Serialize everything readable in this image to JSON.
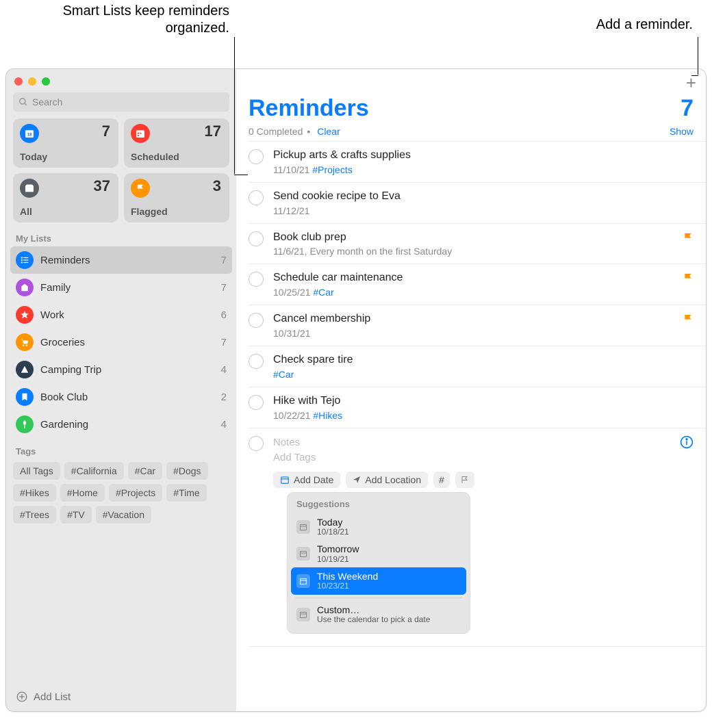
{
  "callouts": {
    "left": "Smart Lists keep reminders organized.",
    "right": "Add a reminder."
  },
  "search": {
    "placeholder": "Search"
  },
  "smart": [
    {
      "label": "Today",
      "count": "7",
      "color": "bg-blue"
    },
    {
      "label": "Scheduled",
      "count": "17",
      "color": "bg-red"
    },
    {
      "label": "All",
      "count": "37",
      "color": "bg-dark"
    },
    {
      "label": "Flagged",
      "count": "3",
      "color": "bg-orange"
    }
  ],
  "mylists_header": "My Lists",
  "lists": [
    {
      "name": "Reminders",
      "count": "7",
      "color": "bg-bluec",
      "selected": true
    },
    {
      "name": "Family",
      "count": "7",
      "color": "bg-purple"
    },
    {
      "name": "Work",
      "count": "6",
      "color": "bg-redc"
    },
    {
      "name": "Groceries",
      "count": "7",
      "color": "bg-orangec"
    },
    {
      "name": "Camping Trip",
      "count": "4",
      "color": "bg-navy"
    },
    {
      "name": "Book Club",
      "count": "2",
      "color": "bg-skyblue"
    },
    {
      "name": "Gardening",
      "count": "4",
      "color": "bg-darkgreen"
    }
  ],
  "tags_header": "Tags",
  "tags": [
    "All Tags",
    "#California",
    "#Car",
    "#Dogs",
    "#Hikes",
    "#Home",
    "#Projects",
    "#Time",
    "#Trees",
    "#TV",
    "#Vacation"
  ],
  "add_list": "Add List",
  "main": {
    "title": "Reminders",
    "count": "7",
    "completed": "0 Completed",
    "dot": "•",
    "clear": "Clear",
    "show": "Show"
  },
  "reminders": [
    {
      "title": "Pickup arts & crafts supplies",
      "meta_date": "11/10/21",
      "meta_tag": "#Projects",
      "flag": false
    },
    {
      "title": "Send cookie recipe to Eva",
      "meta_date": "11/12/21",
      "meta_tag": "",
      "flag": false
    },
    {
      "title": "Book club prep",
      "meta_date": "11/6/21, Every month on the first Saturday",
      "meta_tag": "",
      "flag": true
    },
    {
      "title": "Schedule car maintenance",
      "meta_date": "10/25/21",
      "meta_tag": "#Car",
      "flag": true
    },
    {
      "title": "Cancel membership",
      "meta_date": "10/31/21",
      "meta_tag": "",
      "flag": true
    },
    {
      "title": "Check spare tire",
      "meta_date": "",
      "meta_tag": "#Car",
      "flag": false
    },
    {
      "title": "Hike with Tejo",
      "meta_date": "10/22/21",
      "meta_tag": "#Hikes",
      "flag": false
    }
  ],
  "new_item": {
    "notes_placeholder": "Notes",
    "tags_placeholder": "Add Tags",
    "add_date": "Add Date",
    "add_location": "Add Location"
  },
  "popover": {
    "header": "Suggestions",
    "options": [
      {
        "title": "Today",
        "sub": "10/18/21",
        "selected": false
      },
      {
        "title": "Tomorrow",
        "sub": "10/19/21",
        "selected": false
      },
      {
        "title": "This Weekend",
        "sub": "10/23/21",
        "selected": true
      }
    ],
    "custom_title": "Custom…",
    "custom_sub": "Use the calendar to pick a date"
  }
}
